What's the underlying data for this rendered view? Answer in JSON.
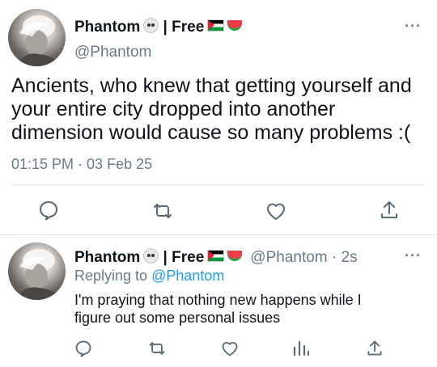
{
  "main_tweet": {
    "display_name": "Phantom",
    "name_suffix": " | Free",
    "handle": "@Phantom",
    "text": "Ancients, who knew that getting yourself and your entire city dropped into another dimension would cause so many problems :(",
    "time": "01:15 PM",
    "separator": " · ",
    "date": "03 Feb 25",
    "more_label": "···",
    "actions": [
      "reply-icon",
      "retweet-icon",
      "like-icon",
      "share-icon"
    ]
  },
  "reply_tweet": {
    "display_name": "Phantom",
    "name_suffix": " | Free",
    "handle": "@Phantom",
    "age": " · 2s",
    "replying_prefix": "Replying to",
    "replying_handle": "@Phantom",
    "text": "I'm praying that nothing new happens while I figure out some personal issues",
    "more_label": "···",
    "actions": [
      "reply-icon",
      "retweet-icon",
      "like-icon",
      "analytics-icon",
      "share-icon"
    ]
  },
  "colors": {
    "text": "#0f1419",
    "secondary": "#6b7a88",
    "link": "#1d9bf0",
    "divider": "#e1e8ed"
  }
}
